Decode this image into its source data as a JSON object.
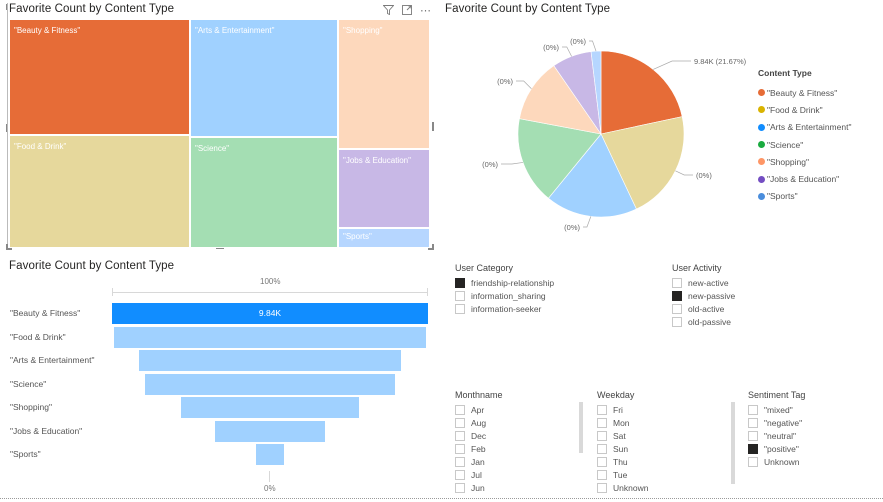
{
  "colors": {
    "beauty_fitness": "#E66C37",
    "food_drink": "#E6D89C",
    "arts_entertainment": "#A0D1FF",
    "science": "#A4DEB3",
    "shopping": "#FDD8BC",
    "jobs_education": "#C8B8E6",
    "sports": "#B6D6FF",
    "funnel_selected": "#118DFF",
    "funnel_unselected": "#A0D1FF"
  },
  "treemap": {
    "title": "Favorite Count by Content Type",
    "icons": [
      "filter-icon",
      "focus-mode-icon",
      "more-options-icon"
    ],
    "tiles": [
      {
        "label": "\"Beauty & Fitness\""
      },
      {
        "label": "\"Food & Drink\""
      },
      {
        "label": "\"Arts & Entertainment\""
      },
      {
        "label": "\"Science\""
      },
      {
        "label": "\"Shopping\""
      },
      {
        "label": "\"Jobs & Education\""
      },
      {
        "label": "\"Sports\""
      }
    ]
  },
  "pie": {
    "title": "Favorite Count by Content Type",
    "legend_title": "Content Type",
    "legend": [
      {
        "label": "\"Beauty & Fitness\"",
        "color": "#E66C37"
      },
      {
        "label": "\"Food & Drink\"",
        "color": "#D9B300"
      },
      {
        "label": "\"Arts & Entertainment\"",
        "color": "#118DFF"
      },
      {
        "label": "\"Science\"",
        "color": "#1AAB40"
      },
      {
        "label": "\"Shopping\"",
        "color": "#FE9666"
      },
      {
        "label": "\"Jobs & Education\"",
        "color": "#744EC2"
      },
      {
        "label": "\"Sports\"",
        "color": "#4A8DDC"
      }
    ],
    "data_labels": [
      "9.84K (21.67%)",
      "(0%)",
      "(0%)",
      "(0%)",
      "(0%)",
      "(0%)",
      "(0%)"
    ]
  },
  "funnel": {
    "title": "Favorite Count by Content Type",
    "top_pct": "100%",
    "bottom_pct": "0%",
    "selected_value": "9.84K",
    "categories": [
      "\"Beauty & Fitness\"",
      "\"Food & Drink\"",
      "\"Arts & Entertainment\"",
      "\"Science\"",
      "\"Shopping\"",
      "\"Jobs & Education\"",
      "\"Sports\""
    ]
  },
  "chart_data": [
    {
      "type": "treemap",
      "title": "Favorite Count by Content Type",
      "categories": [
        "\"Beauty & Fitness\"",
        "\"Food & Drink\"",
        "\"Arts & Entertainment\"",
        "\"Science\"",
        "\"Shopping\"",
        "\"Jobs & Education\"",
        "\"Sports\""
      ],
      "values": [
        9840,
        9700,
        8150,
        7750,
        5650,
        3500,
        870
      ]
    },
    {
      "type": "pie",
      "title": "Favorite Count by Content Type",
      "categories": [
        "\"Beauty & Fitness\"",
        "\"Food & Drink\"",
        "\"Arts & Entertainment\"",
        "\"Science\"",
        "\"Shopping\"",
        "\"Jobs & Education\"",
        "\"Sports\""
      ],
      "values": [
        9840,
        9700,
        8150,
        7750,
        5650,
        3500,
        870
      ],
      "data_labels": [
        "9.84K (21.67%)",
        "(0%)",
        "(0%)",
        "(0%)",
        "(0%)",
        "(0%)",
        "(0%)"
      ],
      "legend_title": "Content Type",
      "legend_position": "right"
    },
    {
      "type": "bar",
      "subtype": "funnel",
      "title": "Favorite Count by Content Type",
      "categories": [
        "\"Beauty & Fitness\"",
        "\"Food & Drink\"",
        "\"Arts & Entertainment\"",
        "\"Science\"",
        "\"Shopping\"",
        "\"Jobs & Education\"",
        "\"Sports\""
      ],
      "values_pct_of_first": [
        100,
        98.5,
        83,
        79,
        56.5,
        35,
        9
      ],
      "selected_label": "9.84K",
      "top_label": "100%",
      "bottom_label": "0%"
    }
  ],
  "slicers": {
    "user_category": {
      "title": "User Category",
      "items": [
        {
          "label": "friendship-relationship",
          "checked": true
        },
        {
          "label": "information_sharing",
          "checked": false
        },
        {
          "label": "information-seeker",
          "checked": false
        }
      ]
    },
    "user_activity": {
      "title": "User Activity",
      "items": [
        {
          "label": "new-active",
          "checked": false
        },
        {
          "label": "new-passive",
          "checked": true
        },
        {
          "label": "old-active",
          "checked": false
        },
        {
          "label": "old-passive",
          "checked": false
        }
      ]
    },
    "monthname": {
      "title": "Monthname",
      "items": [
        {
          "label": "Apr",
          "checked": false
        },
        {
          "label": "Aug",
          "checked": false
        },
        {
          "label": "Dec",
          "checked": false
        },
        {
          "label": "Feb",
          "checked": false
        },
        {
          "label": "Jan",
          "checked": false
        },
        {
          "label": "Jul",
          "checked": false
        },
        {
          "label": "Jun",
          "checked": false
        }
      ]
    },
    "weekday": {
      "title": "Weekday",
      "items": [
        {
          "label": "Fri",
          "checked": false
        },
        {
          "label": "Mon",
          "checked": false
        },
        {
          "label": "Sat",
          "checked": false
        },
        {
          "label": "Sun",
          "checked": false
        },
        {
          "label": "Thu",
          "checked": false
        },
        {
          "label": "Tue",
          "checked": false
        },
        {
          "label": "Unknown",
          "checked": false
        }
      ]
    },
    "sentiment_tag": {
      "title": "Sentiment Tag",
      "items": [
        {
          "label": "\"mixed\"",
          "checked": false
        },
        {
          "label": "\"negative\"",
          "checked": false
        },
        {
          "label": "\"neutral\"",
          "checked": false
        },
        {
          "label": "\"positive\"",
          "checked": true
        },
        {
          "label": "Unknown",
          "checked": false
        }
      ]
    }
  }
}
